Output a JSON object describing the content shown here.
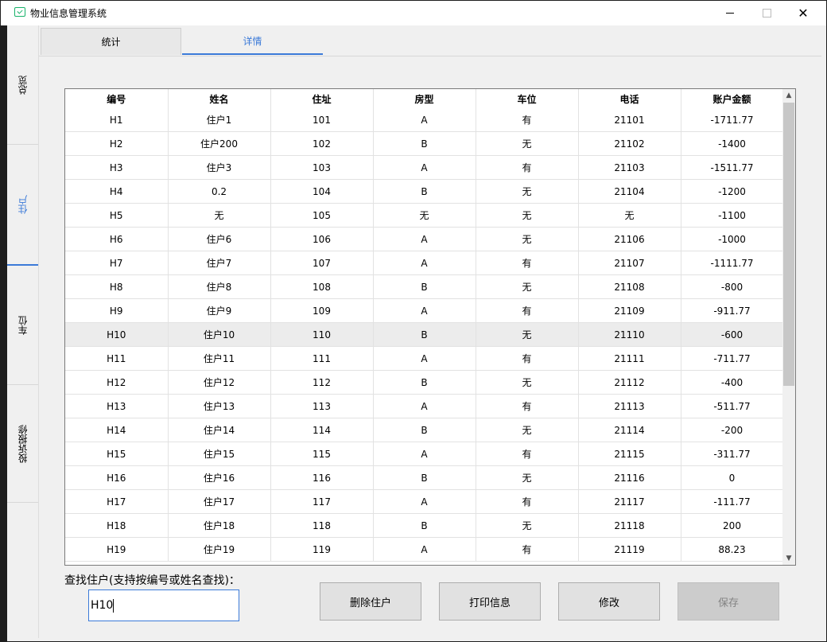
{
  "window": {
    "title": "物业信息管理系统"
  },
  "sidebar": {
    "items": [
      {
        "label": "总览"
      },
      {
        "label": "住户"
      },
      {
        "label": "车位"
      },
      {
        "label": "投诉报修"
      }
    ]
  },
  "tabs": [
    {
      "label": "统计"
    },
    {
      "label": "详情"
    }
  ],
  "table": {
    "headers": [
      "编号",
      "姓名",
      "住址",
      "房型",
      "车位",
      "电话",
      "账户金额"
    ],
    "rows": [
      [
        "H1",
        "住户1",
        "101",
        "A",
        "有",
        "21101",
        "-1711.77"
      ],
      [
        "H2",
        "住户200",
        "102",
        "B",
        "无",
        "21102",
        "-1400"
      ],
      [
        "H3",
        "住户3",
        "103",
        "A",
        "有",
        "21103",
        "-1511.77"
      ],
      [
        "H4",
        "0.2",
        "104",
        "B",
        "无",
        "21104",
        "-1200"
      ],
      [
        "H5",
        "无",
        "105",
        "无",
        "无",
        "无",
        "-1100"
      ],
      [
        "H6",
        "住户6",
        "106",
        "A",
        "无",
        "21106",
        "-1000"
      ],
      [
        "H7",
        "住户7",
        "107",
        "A",
        "有",
        "21107",
        "-1111.77"
      ],
      [
        "H8",
        "住户8",
        "108",
        "B",
        "无",
        "21108",
        "-800"
      ],
      [
        "H9",
        "住户9",
        "109",
        "A",
        "有",
        "21109",
        "-911.77"
      ],
      [
        "H10",
        "住户10",
        "110",
        "B",
        "无",
        "21110",
        "-600"
      ],
      [
        "H11",
        "住户11",
        "111",
        "A",
        "有",
        "21111",
        "-711.77"
      ],
      [
        "H12",
        "住户12",
        "112",
        "B",
        "无",
        "21112",
        "-400"
      ],
      [
        "H13",
        "住户13",
        "113",
        "A",
        "有",
        "21113",
        "-511.77"
      ],
      [
        "H14",
        "住户14",
        "114",
        "B",
        "无",
        "21114",
        "-200"
      ],
      [
        "H15",
        "住户15",
        "115",
        "A",
        "有",
        "21115",
        "-311.77"
      ],
      [
        "H16",
        "住户16",
        "116",
        "B",
        "无",
        "21116",
        "0"
      ],
      [
        "H17",
        "住户17",
        "117",
        "A",
        "有",
        "21117",
        "-111.77"
      ],
      [
        "H18",
        "住户18",
        "118",
        "B",
        "无",
        "21118",
        "200"
      ],
      [
        "H19",
        "住户19",
        "119",
        "A",
        "有",
        "21119",
        "88.23"
      ]
    ],
    "selected_row": "H10"
  },
  "search": {
    "label": "查找住户(支持按编号或姓名查找)：",
    "value": "H10"
  },
  "buttons": {
    "delete": "删除住户",
    "print": "打印信息",
    "edit": "修改",
    "save": "保存"
  }
}
